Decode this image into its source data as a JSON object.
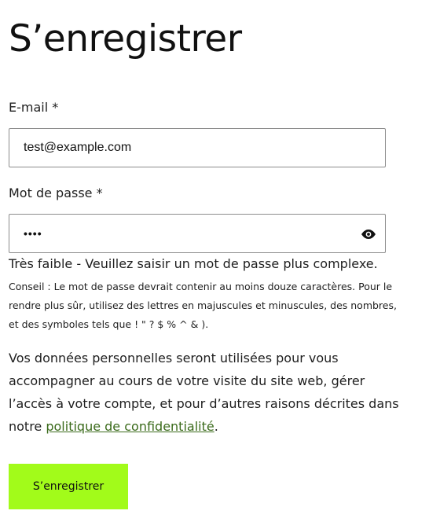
{
  "title": "S’enregistrer",
  "form": {
    "email": {
      "label": "E-mail *",
      "value": "test@example.com"
    },
    "password": {
      "label": "Mot de passe *",
      "value": "••••",
      "toggle_icon": "eye-icon"
    },
    "strength": "Très faible - Veuillez saisir un mot de passe plus complexe.",
    "hint": "Conseil : Le mot de passe devrait contenir au moins douze caractères. Pour le rendre plus sûr, utilisez des lettres en majuscules et minuscules, des nombres, et des symboles tels que ! \" ? $ % ^ & ).",
    "privacy": {
      "text_before": "Vos données personnelles seront utilisées pour vous accompagner au cours de votre visite du site web, gérer l’accès à votre compte, et pour d’autres raisons décrites dans notre ",
      "link_text": "politique de confidentialité",
      "text_after": "."
    },
    "submit_label": "S’enregistrer"
  },
  "colors": {
    "accent": "#a2fb1a",
    "link": "#3a6a1a",
    "text": "#1e1e1e",
    "border": "#8c8c8c"
  }
}
